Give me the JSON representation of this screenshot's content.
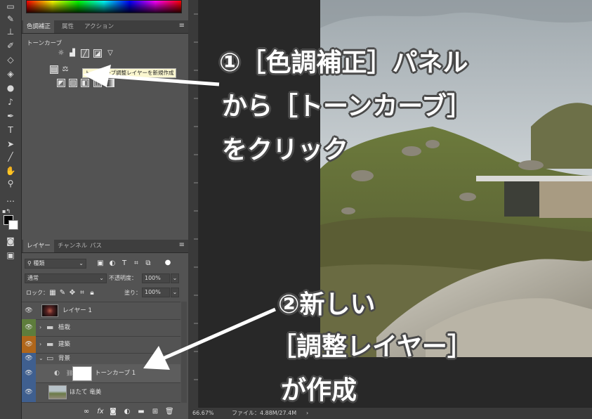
{
  "adjustments_panel": {
    "tabs": [
      {
        "label": "色調補正",
        "active": true
      },
      {
        "label": "属性",
        "active": false
      },
      {
        "label": "アクション",
        "active": false
      }
    ],
    "hover_label": "トーンカーブ",
    "tooltip": "トーンカーブ調整レイヤーを新規作成"
  },
  "layers_panel": {
    "tabs": [
      {
        "label": "レイヤー",
        "active": true
      },
      {
        "label": "チャンネル",
        "active": false
      },
      {
        "label": "パス",
        "active": false
      }
    ],
    "filter_kind": "種類",
    "blend_mode": "通常",
    "opacity_label": "不透明度：",
    "opacity_value": "100%",
    "lock_label": "ロック：",
    "fill_label": "塗り：",
    "fill_value": "100%",
    "layers": [
      {
        "name": "レイヤー 1",
        "type": "layer",
        "color": "none"
      },
      {
        "name": "植栽",
        "type": "group",
        "color": "green"
      },
      {
        "name": "建築",
        "type": "group",
        "color": "orange"
      },
      {
        "name": "背景",
        "type": "group-open",
        "color": "blue"
      },
      {
        "name": "トーンカーブ 1",
        "type": "adjustment",
        "color": "blue"
      },
      {
        "name": "ほたて 竜美",
        "type": "image",
        "color": "blue"
      }
    ]
  },
  "status_bar": {
    "zoom": "66.67%",
    "file_info": "ファイル：4.88M/27.4M"
  },
  "callouts": {
    "step1_line1": "①［色調補正］パネル",
    "step1_line2": "から［トーンカーブ］",
    "step1_line3": "をクリック",
    "step2_line1": "②新しい",
    "step2_line2": "［調整レイヤー］",
    "step2_line3": "が作成"
  },
  "colors": {
    "panel_bg": "#535353",
    "callout_text": "#ffffff",
    "callout_outline": "#4a4a4a"
  }
}
